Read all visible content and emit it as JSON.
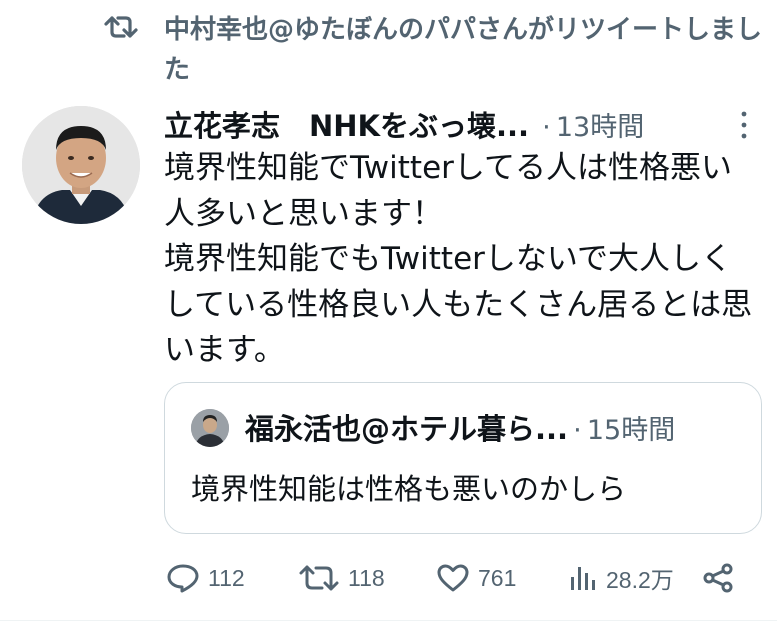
{
  "retweet": {
    "icon": "retweet-icon",
    "text": "中村幸也@ゆたぼんのパパさんがリツイートしました"
  },
  "tweet": {
    "author": "立花孝志　NHKをぶっ壊...",
    "separator": "·",
    "time": "13時間",
    "text": "境界性知能でTwitterしてる人は性格悪い人多いと思います！\n境界性知能でもTwitterしないで大人しくしている性格良い人もたくさん居るとは思います。"
  },
  "quote": {
    "author": "福永活也@ホテル暮ら...",
    "separator": "·",
    "time": "15時間",
    "text": "境界性知能は性格も悪いのかしら"
  },
  "actions": {
    "replies": "112",
    "retweets": "118",
    "likes": "761",
    "views": "28.2万"
  },
  "colors": {
    "text": "#0f1419",
    "muted": "#536471",
    "border": "#cfd9de"
  }
}
